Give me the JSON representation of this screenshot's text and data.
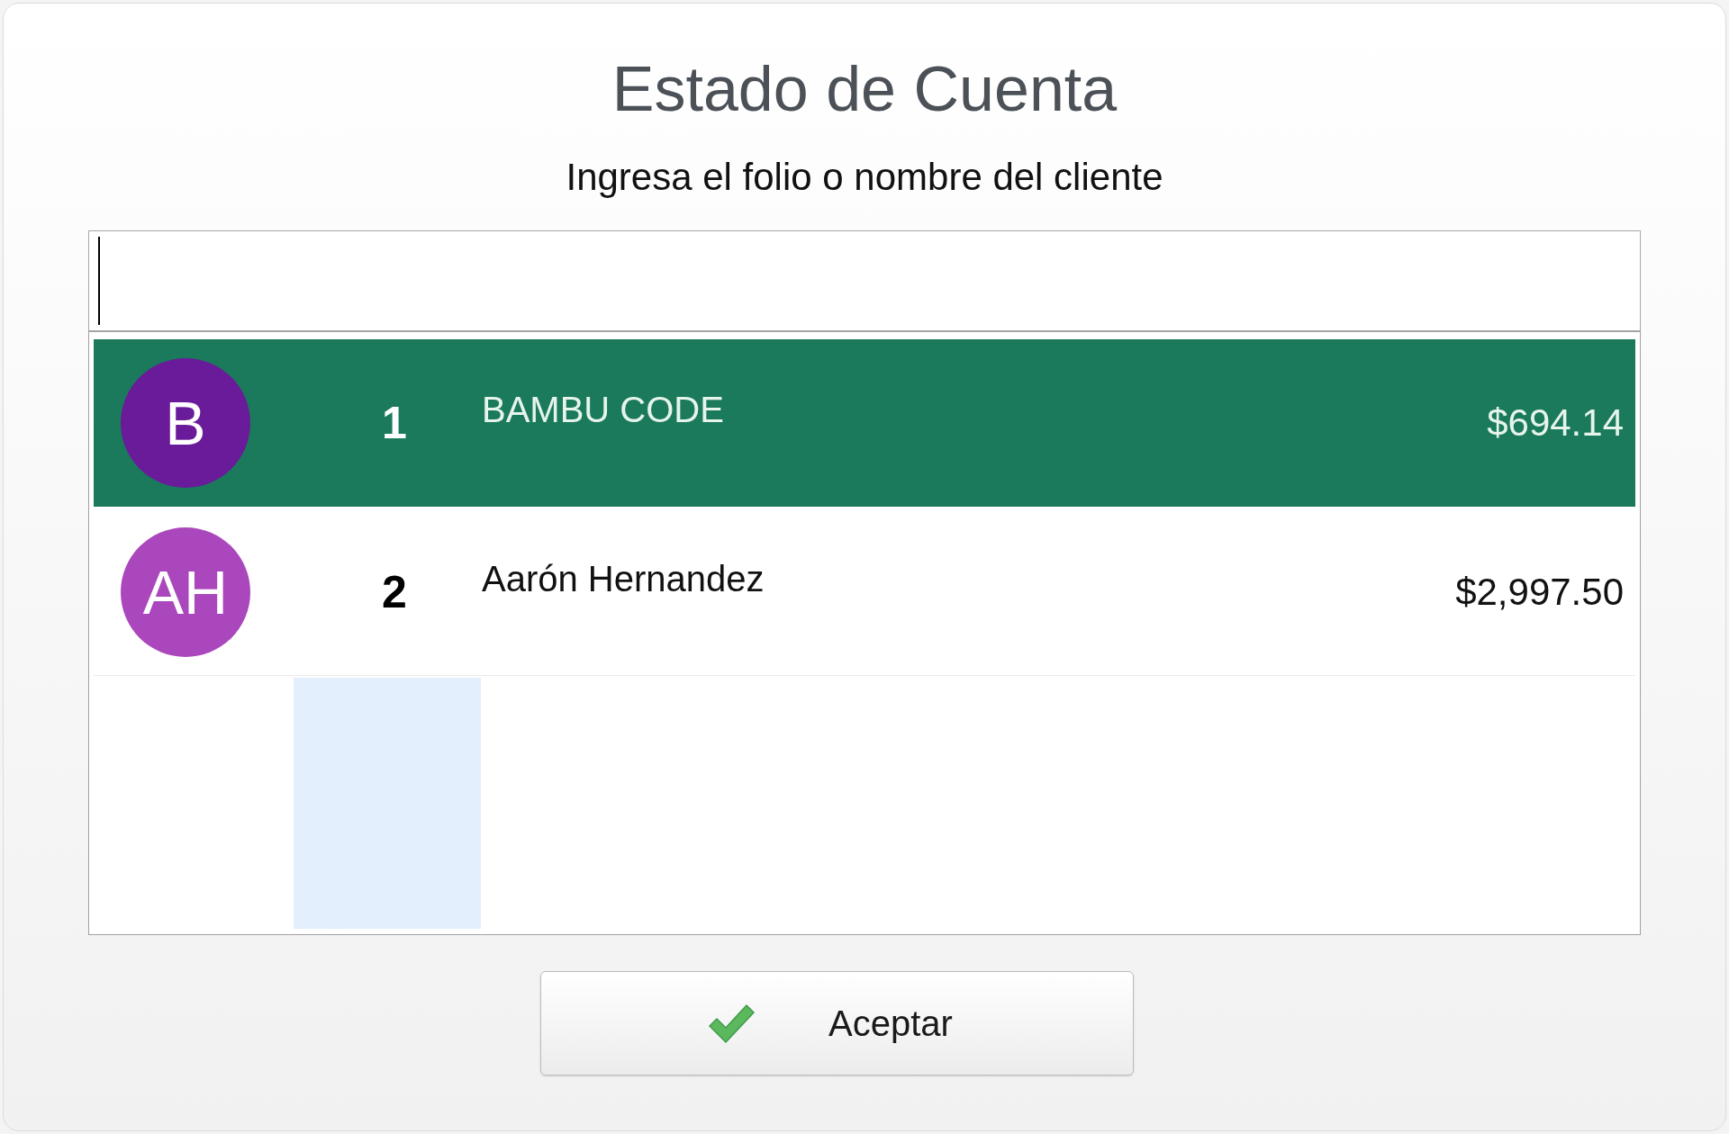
{
  "dialog": {
    "title": "Estado de Cuenta",
    "subtitle": "Ingresa el folio o nombre del cliente"
  },
  "search": {
    "focused": true
  },
  "clients": [
    {
      "initials": "B",
      "color": "#6a1b9a",
      "folio": "1",
      "name": "BAMBU CODE",
      "balance": "$694.14",
      "selected": true
    },
    {
      "initials": "AH",
      "color": "#ab47bc",
      "folio": "2",
      "name": "Aarón Hernandez",
      "balance": "$2,997.50",
      "selected": false
    }
  ],
  "accept_button": {
    "label": "Aceptar"
  }
}
